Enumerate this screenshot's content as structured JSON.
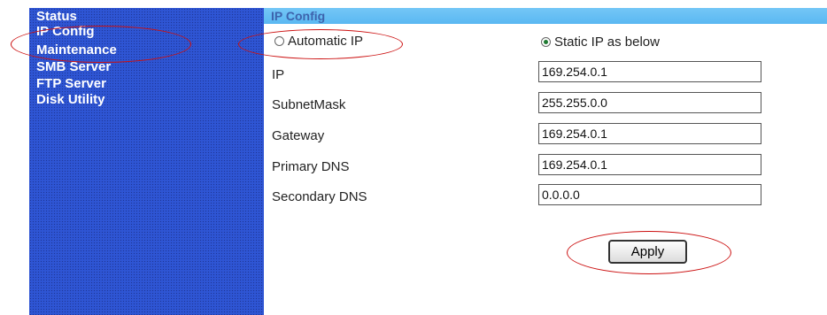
{
  "sidebar": {
    "items": [
      {
        "label": "Status"
      },
      {
        "label": "IP Config"
      },
      {
        "label": "Maintenance"
      },
      {
        "label": "SMB Server"
      },
      {
        "label": "FTP Server"
      },
      {
        "label": "Disk Utility"
      }
    ]
  },
  "header": {
    "title": "IP Config"
  },
  "mode": {
    "automatic_label": "Automatic IP",
    "static_label": "Static IP as below",
    "selected": "static"
  },
  "fields": [
    {
      "label": "IP",
      "value": "169.254.0.1"
    },
    {
      "label": "SubnetMask",
      "value": "255.255.0.0"
    },
    {
      "label": "Gateway",
      "value": "169.254.0.1"
    },
    {
      "label": "Primary DNS",
      "value": "169.254.0.1"
    },
    {
      "label": "Secondary DNS",
      "value": "0.0.0.0"
    }
  ],
  "apply_label": "Apply",
  "colors": {
    "annotation": "#cc1111",
    "sidebar": "#2e55d4",
    "header": "#5ab8f2"
  }
}
